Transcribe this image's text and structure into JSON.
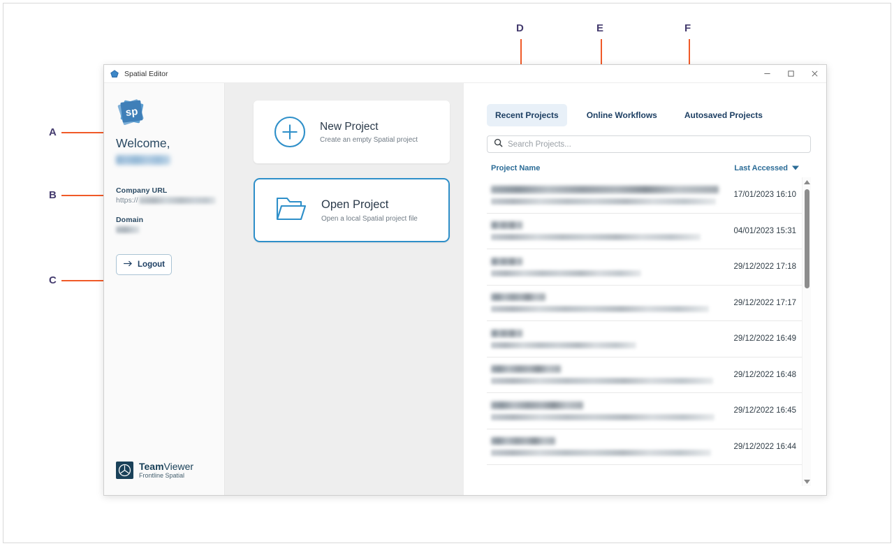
{
  "window": {
    "title": "Spatial Editor",
    "icon": "spatial-diamond-icon",
    "controls": {
      "minimize": "minimize-icon",
      "maximize": "maximize-icon",
      "close": "close-icon"
    }
  },
  "callouts": [
    {
      "letter": "A",
      "target": "new-project-card"
    },
    {
      "letter": "B",
      "target": "open-project-card"
    },
    {
      "letter": "C",
      "target": "logout-button"
    },
    {
      "letter": "D",
      "target": "tab-recent-projects"
    },
    {
      "letter": "E",
      "target": "tab-online-workflows"
    },
    {
      "letter": "F",
      "target": "tab-autosaved-projects"
    }
  ],
  "sidebar": {
    "logo": "sp-logo-icon",
    "welcome": "Welcome,",
    "username_redacted": true,
    "company_url_label": "Company URL",
    "company_url_prefix": "https://",
    "company_url_redacted": true,
    "domain_label": "Domain",
    "domain_redacted": true,
    "logout_label": "Logout",
    "brand": {
      "name_bold": "Team",
      "name_light": "Viewer",
      "product": "Frontline Spatial"
    }
  },
  "actions": [
    {
      "id": "new-project",
      "icon": "plus-circle-icon",
      "title": "New Project",
      "subtitle": "Create an empty Spatial project",
      "selected": false
    },
    {
      "id": "open-project",
      "icon": "folder-open-icon",
      "title": "Open Project",
      "subtitle": "Open a local Spatial project file",
      "selected": true
    }
  ],
  "panel": {
    "tabs": [
      {
        "label": "Recent Projects",
        "active": true
      },
      {
        "label": "Online Workflows",
        "active": false
      },
      {
        "label": "Autosaved Projects",
        "active": false
      }
    ],
    "search": {
      "placeholder": "Search Projects...",
      "value": "",
      "icon": "search-icon"
    },
    "columns": {
      "name": "Project Name",
      "date": "Last Accessed",
      "sort_icon": "sort-descending-icon"
    },
    "rows": [
      {
        "name_redacted": true,
        "name_width": 326,
        "path_redacted": true,
        "path_width": 322,
        "date": "17/01/2023 16:10"
      },
      {
        "name_redacted": true,
        "name_width": 45,
        "path_redacted": true,
        "path_width": 300,
        "date": "04/01/2023 15:31"
      },
      {
        "name_redacted": true,
        "name_width": 45,
        "path_redacted": true,
        "path_width": 215,
        "date": "29/12/2022 17:18"
      },
      {
        "name_redacted": true,
        "name_width": 78,
        "path_redacted": true,
        "path_width": 312,
        "date": "29/12/2022 17:17"
      },
      {
        "name_redacted": true,
        "name_width": 45,
        "path_redacted": true,
        "path_width": 208,
        "date": "29/12/2022 16:49"
      },
      {
        "name_redacted": true,
        "name_width": 100,
        "path_redacted": true,
        "path_width": 318,
        "date": "29/12/2022 16:48"
      },
      {
        "name_redacted": true,
        "name_width": 132,
        "path_redacted": true,
        "path_width": 320,
        "date": "29/12/2022 16:45"
      },
      {
        "name_redacted": true,
        "name_width": 92,
        "path_redacted": true,
        "path_width": 315,
        "date": "29/12/2022 16:44"
      }
    ],
    "scrollbar": {
      "up_icon": "caret-up-icon",
      "down_icon": "caret-down-icon",
      "thumb_position": "top"
    }
  },
  "colors": {
    "accent_blue": "#2e8fc9",
    "callout_orange": "#f05a28",
    "callout_letter": "#443b6e",
    "heading_navy": "#2b4a63",
    "column_header": "#2a6b96",
    "panel_gray": "#eeeeee",
    "sidebar_gray": "#fafafa",
    "brand_dark": "#1a4159"
  }
}
